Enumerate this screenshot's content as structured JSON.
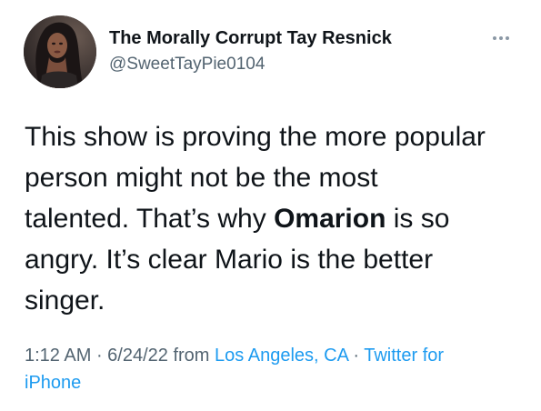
{
  "user": {
    "display_name": "The Morally Corrupt Tay Resnick",
    "handle": "@SweetTayPie0104"
  },
  "icons": {
    "more": "more-horizontal-icon",
    "avatar": "profile-avatar"
  },
  "tweet": {
    "lines": [
      {
        "text": "This show is proving the more popular"
      },
      {
        "text": "person might not be the most"
      },
      {
        "text": "talented. That’s why ",
        "bold": "Omarion",
        "after": " is so"
      },
      {
        "text": "angry. It’s clear Mario is the better"
      },
      {
        "text": "singer."
      }
    ]
  },
  "meta": {
    "time": "1:12 AM",
    "sep1": " · ",
    "date": "6/24/22",
    "from_label": " from ",
    "location": "Los Angeles, CA",
    "sep2": " · ",
    "source_part1": "Twitter for",
    "source_part2": "iPhone"
  },
  "colors": {
    "text": "#0f1419",
    "secondary": "#536471",
    "link": "#1d9bf0"
  }
}
